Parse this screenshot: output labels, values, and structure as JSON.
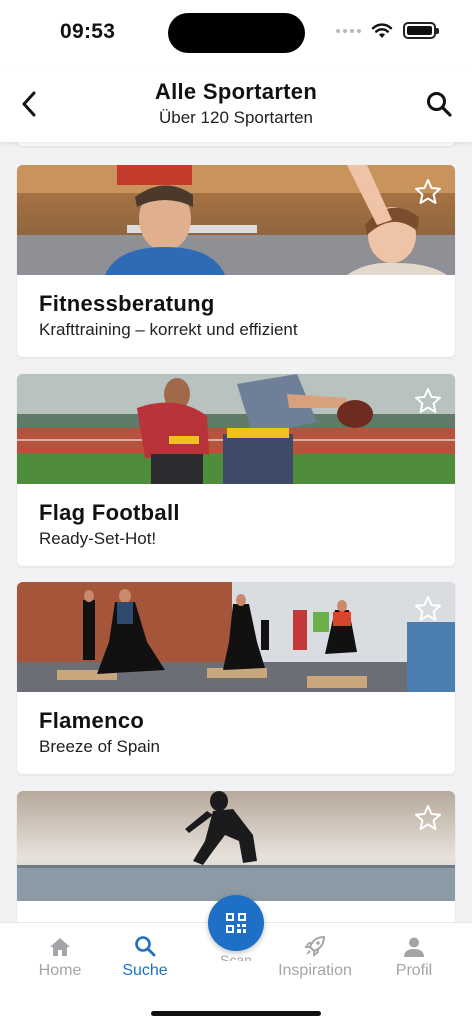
{
  "status_bar": {
    "time": "09:53"
  },
  "header": {
    "title": "Alle Sportarten",
    "subtitle": "Über 120 Sportarten",
    "back_icon": "chevron-left-icon",
    "search_icon": "search-icon"
  },
  "cards": [
    {
      "title": "Fitnessberatung",
      "subtitle": "Krafttraining – korrekt und effizient",
      "favorite": false
    },
    {
      "title": "Flag Football",
      "subtitle": "Ready-Set-Hot!",
      "favorite": false
    },
    {
      "title": "Flamenco",
      "subtitle": "Breeze of Spain",
      "favorite": false
    },
    {
      "title": "",
      "subtitle": "",
      "favorite": false
    }
  ],
  "tab_bar": {
    "tabs": [
      {
        "label": "Home",
        "icon": "home-icon",
        "active": false
      },
      {
        "label": "Suche",
        "icon": "search-icon",
        "active": true
      },
      {
        "label": "Inspiration",
        "icon": "rocket-icon",
        "active": false
      },
      {
        "label": "Profil",
        "icon": "person-icon",
        "active": false
      }
    ],
    "scan_label": "Scan",
    "scan_icon": "qr-code-icon"
  },
  "colors": {
    "accent": "#1e6fc6",
    "inactive": "#a5a5a9",
    "background": "#f2f2f4"
  }
}
